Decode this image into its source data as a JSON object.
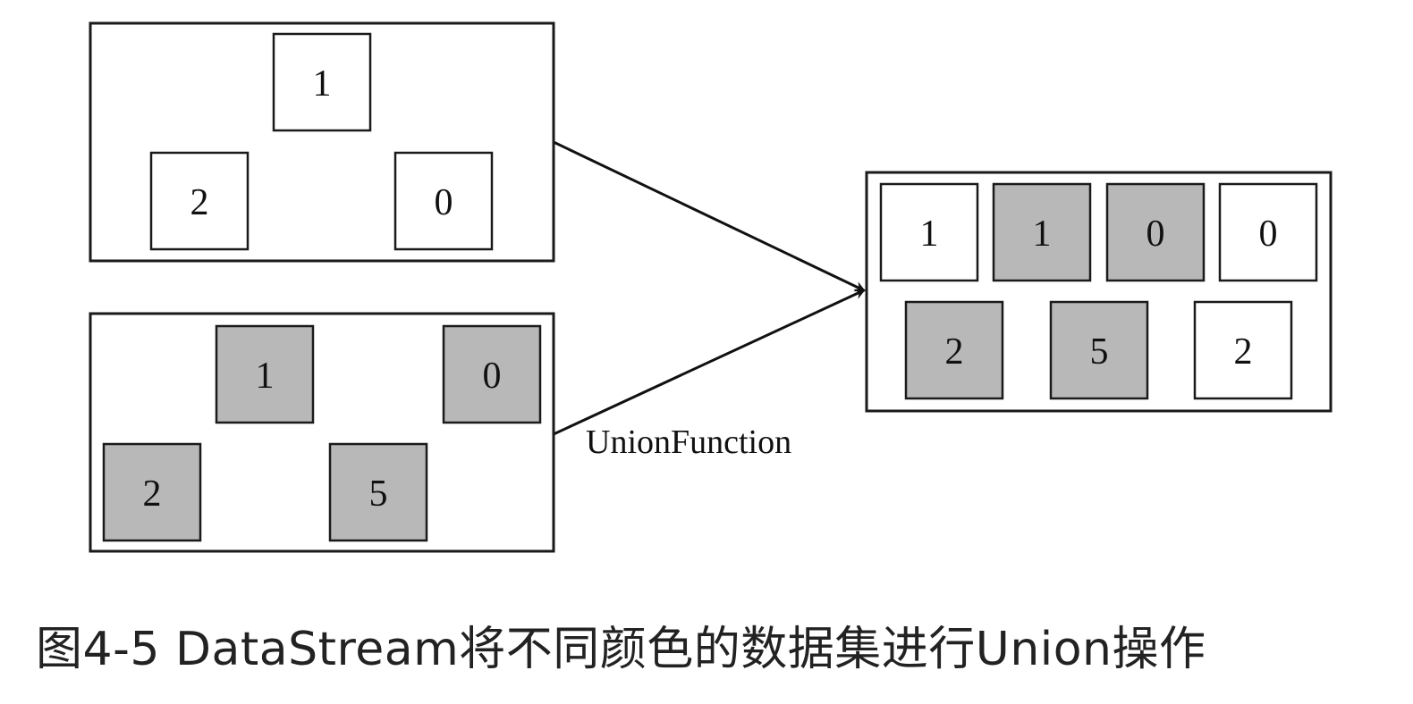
{
  "colors": {
    "white": "#ffffff",
    "gray": "#b8b8b8",
    "stroke": "#1a1a1a"
  },
  "containers": [
    {
      "name": "stream-white",
      "items": [
        {
          "label": "1",
          "fill": "white"
        },
        {
          "label": "2",
          "fill": "white"
        },
        {
          "label": "0",
          "fill": "white"
        }
      ]
    },
    {
      "name": "stream-gray",
      "items": [
        {
          "label": "1",
          "fill": "gray"
        },
        {
          "label": "0",
          "fill": "gray"
        },
        {
          "label": "2",
          "fill": "gray"
        },
        {
          "label": "5",
          "fill": "gray"
        }
      ]
    },
    {
      "name": "stream-union",
      "items": [
        {
          "label": "1",
          "fill": "white"
        },
        {
          "label": "1",
          "fill": "gray"
        },
        {
          "label": "0",
          "fill": "gray"
        },
        {
          "label": "0",
          "fill": "white"
        },
        {
          "label": "2",
          "fill": "gray"
        },
        {
          "label": "5",
          "fill": "gray"
        },
        {
          "label": "2",
          "fill": "white"
        }
      ]
    }
  ],
  "edges": [
    {
      "from": "stream-white",
      "to": "stream-union"
    },
    {
      "from": "stream-gray",
      "to": "stream-union",
      "label": "UnionFunction"
    }
  ],
  "caption": "图4-5 DataStream将不同颜色的数据集进行Union操作"
}
